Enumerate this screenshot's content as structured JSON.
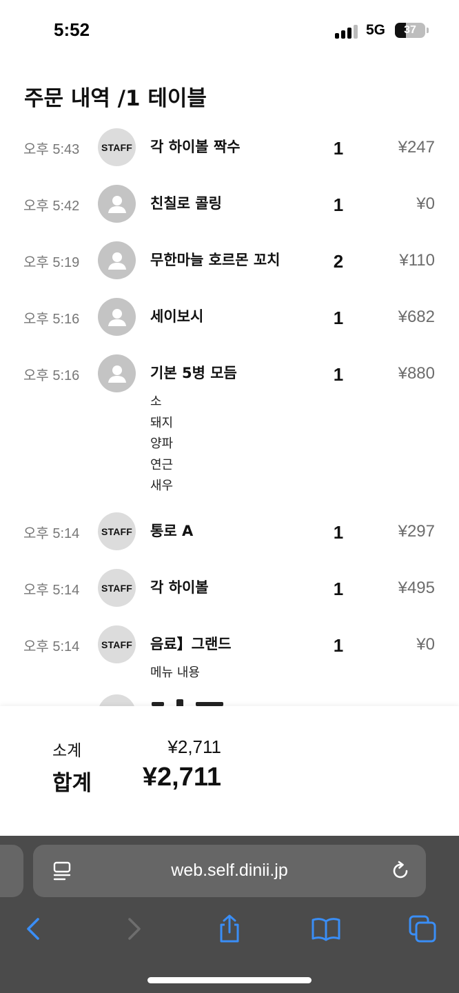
{
  "status_bar": {
    "time": "5:52",
    "network": "5G",
    "battery": "37",
    "battery_level": 0.37
  },
  "page": {
    "title": "주문 내역 /1 테이블"
  },
  "orders": [
    {
      "time": "오후 5:43",
      "avatar": "staff",
      "avatar_label": "STAFF",
      "name": "각 하이볼 짝수",
      "qty": "1",
      "price": "¥247",
      "options": []
    },
    {
      "time": "오후 5:42",
      "avatar": "user",
      "name": "친칠로 콜링",
      "qty": "1",
      "price": "¥0",
      "options": []
    },
    {
      "time": "오후 5:19",
      "avatar": "user",
      "name": "무한마늘 호르몬 꼬치",
      "qty": "2",
      "price": "¥110",
      "options": []
    },
    {
      "time": "오후 5:16",
      "avatar": "user",
      "name": "세이보시",
      "qty": "1",
      "price": "¥682",
      "options": []
    },
    {
      "time": "오후 5:16",
      "avatar": "user",
      "name": "기본 5병 모듬",
      "qty": "1",
      "price": "¥880",
      "options": [
        "소",
        "돼지",
        "양파",
        "연근",
        "새우"
      ]
    },
    {
      "time": "오후 5:14",
      "avatar": "staff",
      "avatar_label": "STAFF",
      "name": "통로 A",
      "qty": "1",
      "price": "¥297",
      "options": []
    },
    {
      "time": "오후 5:14",
      "avatar": "staff",
      "avatar_label": "STAFF",
      "name": "각 하이볼",
      "qty": "1",
      "price": "¥495",
      "options": []
    },
    {
      "time": "오후 5:14",
      "avatar": "staff",
      "avatar_label": "STAFF",
      "name": "음료】그랜드",
      "qty": "1",
      "price": "¥0",
      "options": [
        "메뉴 내용"
      ]
    }
  ],
  "totals": {
    "subtotal_label": "소계",
    "subtotal_value": "¥2,711",
    "total_label": "합계",
    "total_value": "¥2,711"
  },
  "browser": {
    "url": "web.self.dinii.jp",
    "icons": {
      "reader": "reader-mode-icon",
      "reload": "reload-icon",
      "back": "back-chevron-icon",
      "forward": "forward-chevron-icon",
      "share": "share-icon",
      "bookmarks": "bookmarks-icon",
      "tabs": "tabs-icon"
    },
    "colors": {
      "accent": "#3a8ef6",
      "disabled": "#6e6e6e",
      "chrome_bg": "#4b4b4b",
      "address_bar_bg": "#666666"
    }
  }
}
